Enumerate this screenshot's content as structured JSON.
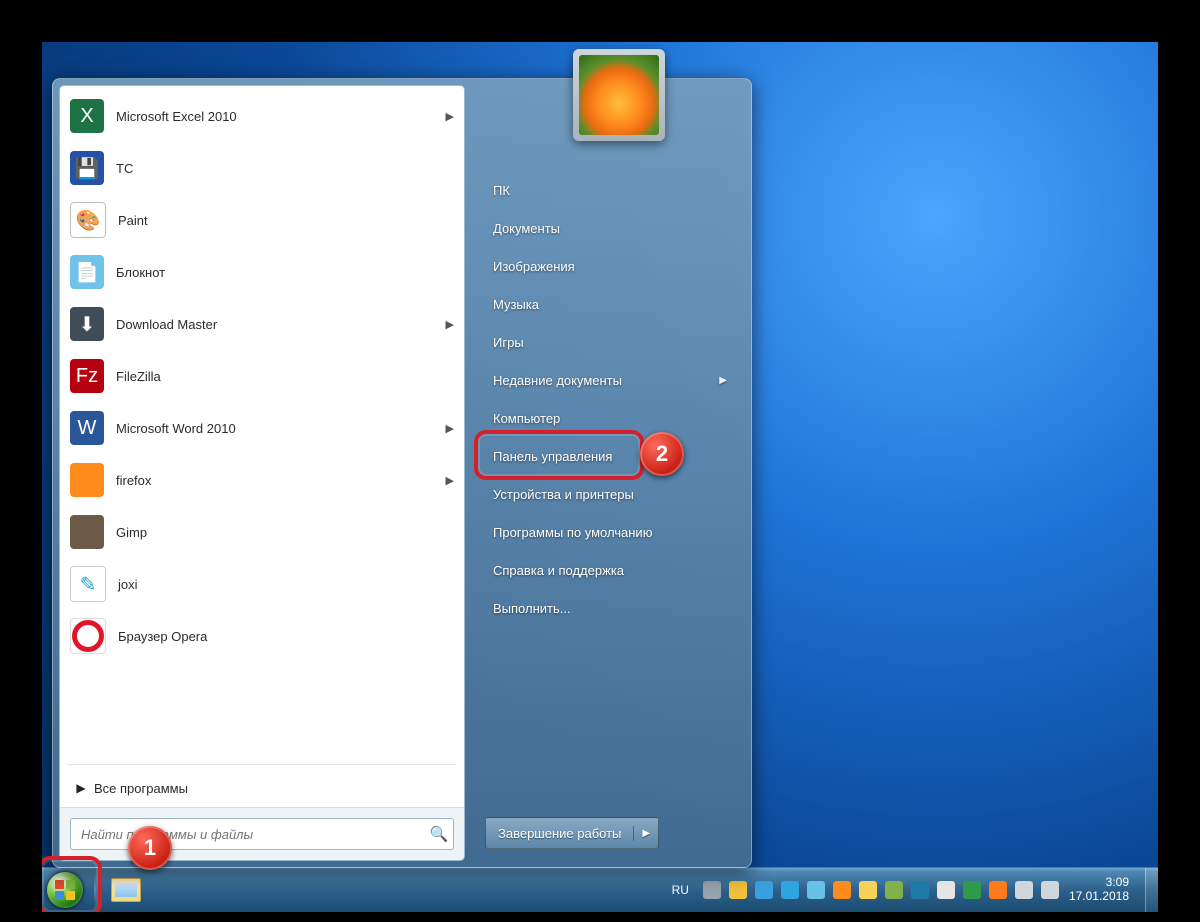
{
  "programs": [
    {
      "label": "Microsoft Excel 2010",
      "icon": "ic-excel",
      "glyph": "X",
      "arrow": true
    },
    {
      "label": "TC",
      "icon": "ic-tc",
      "glyph": "💾",
      "arrow": false
    },
    {
      "label": "Paint",
      "icon": "ic-paint",
      "glyph": "🎨",
      "arrow": false
    },
    {
      "label": "Блокнот",
      "icon": "ic-note",
      "glyph": "📄",
      "arrow": false
    },
    {
      "label": "Download Master",
      "icon": "ic-dm",
      "glyph": "⬇",
      "arrow": true
    },
    {
      "label": "FileZilla",
      "icon": "ic-fz",
      "glyph": "Fz",
      "arrow": false
    },
    {
      "label": "Microsoft Word 2010",
      "icon": "ic-word",
      "glyph": "W",
      "arrow": true
    },
    {
      "label": "firefox",
      "icon": "ic-ff",
      "glyph": "",
      "arrow": true
    },
    {
      "label": "Gimp",
      "icon": "ic-gimp",
      "glyph": "",
      "arrow": false
    },
    {
      "label": "joxi",
      "icon": "ic-joxi",
      "glyph": "✎",
      "arrow": false
    },
    {
      "label": "Браузер Opera",
      "icon": "ic-opera",
      "glyph": "",
      "arrow": false
    }
  ],
  "all_programs": "Все программы",
  "search_placeholder": "Найти программы и файлы",
  "right": {
    "pc": "ПК",
    "docs": "Документы",
    "pics": "Изображения",
    "music": "Музыка",
    "games": "Игры",
    "recent": "Недавние документы",
    "computer": "Компьютер",
    "cpanel": "Панель управления",
    "devices": "Устройства и принтеры",
    "defaults": "Программы по умолчанию",
    "help": "Справка и поддержка",
    "run": "Выполнить..."
  },
  "shutdown_label": "Завершение работы",
  "tray": {
    "lang": "RU",
    "time": "3:09",
    "date": "17.01.2018"
  },
  "tray_icons": [
    {
      "name": "keyboard-icon",
      "bg": "#9aa4ac"
    },
    {
      "name": "shield-icon",
      "bg": "#f0c23a"
    },
    {
      "name": "chat-icon",
      "bg": "#3aa0e0"
    },
    {
      "name": "telegram-icon",
      "bg": "#2ca5e0"
    },
    {
      "name": "screenshot-icon",
      "bg": "#66c2e8"
    },
    {
      "name": "firefox-icon",
      "bg": "#ff8a1d"
    },
    {
      "name": "note-icon",
      "bg": "#f5d25a"
    },
    {
      "name": "network-icon",
      "bg": "#7fb24a"
    },
    {
      "name": "globe-icon",
      "bg": "#1e7aa8"
    },
    {
      "name": "flag-icon",
      "bg": "#e5e5e5"
    },
    {
      "name": "recycle-icon",
      "bg": "#2e9a4a"
    },
    {
      "name": "app-icon",
      "bg": "#ff7b1a"
    },
    {
      "name": "signal-icon",
      "bg": "#cfd6dc"
    },
    {
      "name": "volume-icon",
      "bg": "#cfd6dc"
    }
  ],
  "annotations": {
    "1": "1",
    "2": "2"
  }
}
